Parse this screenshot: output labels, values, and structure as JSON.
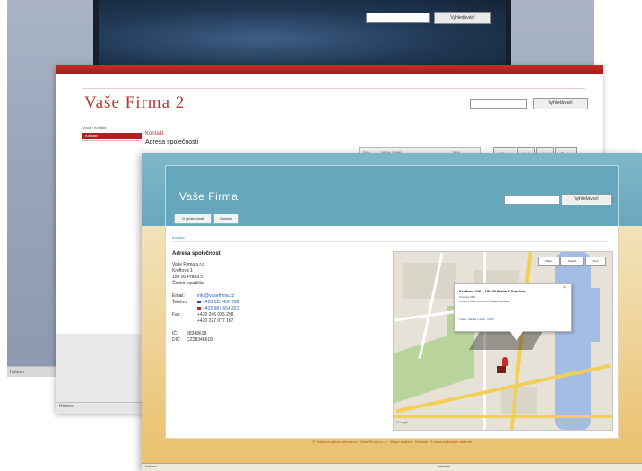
{
  "back_window": {
    "search_button_label": "Vyhledávání",
    "status_text": "Hotovo"
  },
  "middle_window": {
    "site_title": "Vaše Firma 2",
    "search_button_label": "Vyhledávání",
    "breadcrumb": "Úvod › Kontakt",
    "sidebar_active_item": "Kontakt",
    "section_label": "Kontakt",
    "page_heading": "Adresa společnosti",
    "table_cells": [
      "Úvod",
      "Adresa / Kontakt",
      "Mapa"
    ],
    "tabs": [
      "Mapa",
      "Sat",
      "Hyb",
      "Terén"
    ],
    "status_text": "Hotovo"
  },
  "front_window": {
    "site_title": "Vaše Firma",
    "search_button_label": "Vyhledávání",
    "nav_tabs": [
      "O společnosti",
      "Kontakt"
    ],
    "breadcrumb": "Kontakt",
    "content_heading": "Adresa společnosti",
    "address_lines": [
      "Vaše Firma s.r.o.",
      "Kroftova 1",
      "150 00 Praha 5",
      "Česká republika"
    ],
    "email_label": "Email:",
    "email_value": "info@vasefirma.cz",
    "phone_label": "Telefon:",
    "phone_values": [
      "+420 123 456 789",
      "+420 987 654 321"
    ],
    "fax_label": "Fax:",
    "fax_values": [
      "+420 246 035 298",
      "+420 227 077 187"
    ],
    "ic_label": "IČ:",
    "ic_value": "28348618",
    "dic_label": "DIČ:",
    "dic_value": "CZ28348618",
    "map": {
      "popup_title": "Kroftova 2361, 150 00 Praha 5-Smíchov",
      "popup_line1": "Kroftova 2361",
      "popup_line2": "150 00 Praha 5-Smíchov, Česká republika",
      "popup_links": "Trasa · Hledat v okolí · Uložit",
      "controls": [
        "Mapa",
        "Satelit",
        "Terén"
      ],
      "attribution": "Google"
    },
    "footer_text": "© Všechna práva vyhrazena · Vaše Firma s.r.o. · Mapa stránek · Kontakt · Tvorba webových stránek",
    "taskbar_left": "Hotovo",
    "taskbar_right": "Internet"
  },
  "colors": {
    "red_accent": "#a52620",
    "title_red": "#b23a31",
    "teal_header": "#6aa8bd",
    "sand_bg": "#f0d9a6",
    "link_blue": "#2a5fa8"
  }
}
